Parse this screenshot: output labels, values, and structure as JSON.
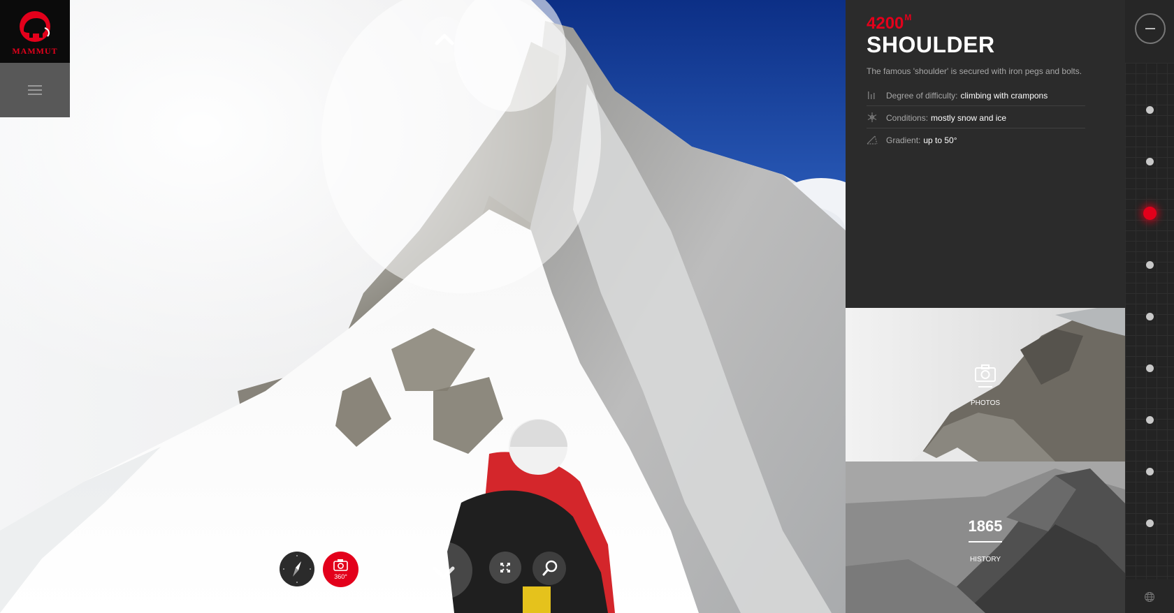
{
  "brand": {
    "logo_text": "MAMMUT",
    "accent": "#e3001b"
  },
  "info": {
    "altitude": "4200",
    "altitude_unit": "M",
    "title": "SHOULDER",
    "description": "The famous 'shoulder' is secured with iron pegs and bolts.",
    "properties": [
      {
        "icon": "bar-chart-icon",
        "label": "Degree of difficulty:",
        "value": "climbing with crampons"
      },
      {
        "icon": "snowflake-icon",
        "label": "Conditions:",
        "value": "mostly snow and ice"
      },
      {
        "icon": "slope-icon",
        "label": "Gradient:",
        "value": "up to 50°"
      }
    ]
  },
  "tiles": {
    "photos": {
      "label": "PHOTOS",
      "icon": "camera-icon"
    },
    "history": {
      "year": "1865",
      "label": "HISTORY"
    }
  },
  "controls": {
    "cam360_label": "360°",
    "icons": [
      "compass-icon",
      "camera-icon",
      "chevron-down-icon",
      "fullscreen-icon",
      "zoom-icon",
      "chevron-up-icon",
      "menu-icon",
      "minus-icon",
      "globe-icon"
    ]
  },
  "rail": {
    "waypoint_count": 9,
    "active_index": 2
  }
}
